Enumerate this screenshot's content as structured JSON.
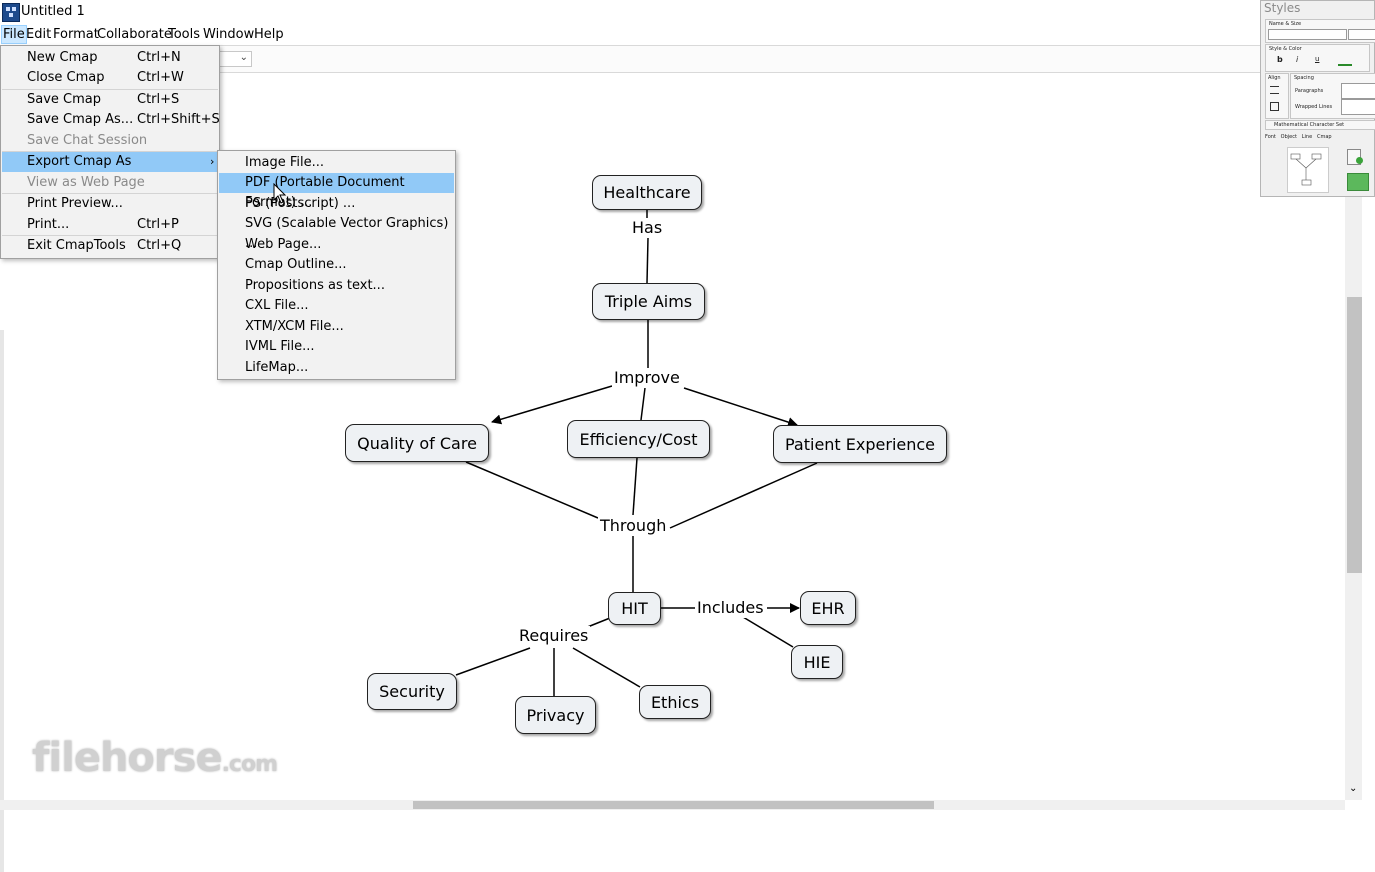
{
  "window": {
    "title": "Untitled 1"
  },
  "menubar": {
    "items": [
      "File",
      "Edit",
      "Format",
      "Collaborate",
      "Tools",
      "Window",
      "Help"
    ]
  },
  "file_menu": [
    {
      "label": "New Cmap",
      "shortcut": "Ctrl+N"
    },
    {
      "label": "Close Cmap",
      "shortcut": "Ctrl+W"
    },
    {
      "label": "Save Cmap",
      "shortcut": "Ctrl+S"
    },
    {
      "label": "Save Cmap As...",
      "shortcut": "Ctrl+Shift+S"
    },
    {
      "label": "Save Chat Session",
      "shortcut": "",
      "disabled": true
    },
    {
      "label": "Export Cmap As",
      "shortcut": "",
      "highlighted": true
    },
    {
      "label": "View as Web Page",
      "shortcut": "",
      "disabled": true
    },
    {
      "label": "Print Preview...",
      "shortcut": ""
    },
    {
      "label": "Print...",
      "shortcut": "Ctrl+P"
    },
    {
      "label": "Exit CmapTools",
      "shortcut": "Ctrl+Q"
    }
  ],
  "export_menu": [
    "Image File...",
    "PDF (Portable Document Format) ...",
    "PS (Postscript) ...",
    "SVG (Scalable Vector Graphics) ...",
    "Web Page...",
    "Cmap Outline...",
    "Propositions as text...",
    "CXL File...",
    "XTM/XCM File...",
    "IVML File...",
    "LifeMap..."
  ],
  "export_highlighted_index": 1,
  "concepts": {
    "healthcare": "Healthcare",
    "triple_aims": "Triple Aims",
    "quality": "Quality of Care",
    "efficiency": "Efficiency/Cost",
    "patient": "Patient Experience",
    "hit": "HIT",
    "ehr": "EHR",
    "hie": "HIE",
    "security": "Security",
    "privacy": "Privacy",
    "ethics": "Ethics"
  },
  "links": {
    "has": "Has",
    "improve": "Improve",
    "through": "Through",
    "includes": "Includes",
    "requires": "Requires"
  },
  "styles_panel": {
    "title": "Styles",
    "name_size": "Name & Size",
    "style_color": "Style & Color",
    "align": "Align",
    "spacing": "Spacing",
    "paragraphs": "Paragraphs",
    "wrapped_lines": "Wrapped Lines",
    "charset": "Mathematical Character Set",
    "tabs": [
      "Font",
      "Object",
      "Line",
      "Cmap"
    ],
    "bold": "b",
    "italic": "i",
    "underline": "u"
  },
  "watermark": {
    "main": "filehorse",
    "suffix": ".com"
  },
  "colors": {
    "menu_highlight": "#91c9f7",
    "concept_fill": "#eef1f4"
  }
}
